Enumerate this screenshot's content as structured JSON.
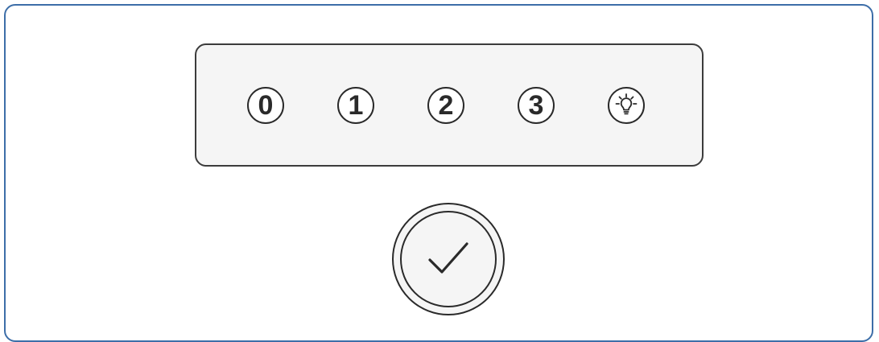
{
  "keypad": {
    "keys": [
      {
        "label": "0"
      },
      {
        "label": "1"
      },
      {
        "label": "2"
      },
      {
        "label": "3"
      }
    ],
    "hint_icon": "lightbulb-icon"
  },
  "confirm": {
    "icon": "checkmark-icon"
  },
  "colors": {
    "frame_border": "#3d6ea8",
    "outline": "#2a2a2a",
    "panel_fill": "#f5f5f5"
  }
}
